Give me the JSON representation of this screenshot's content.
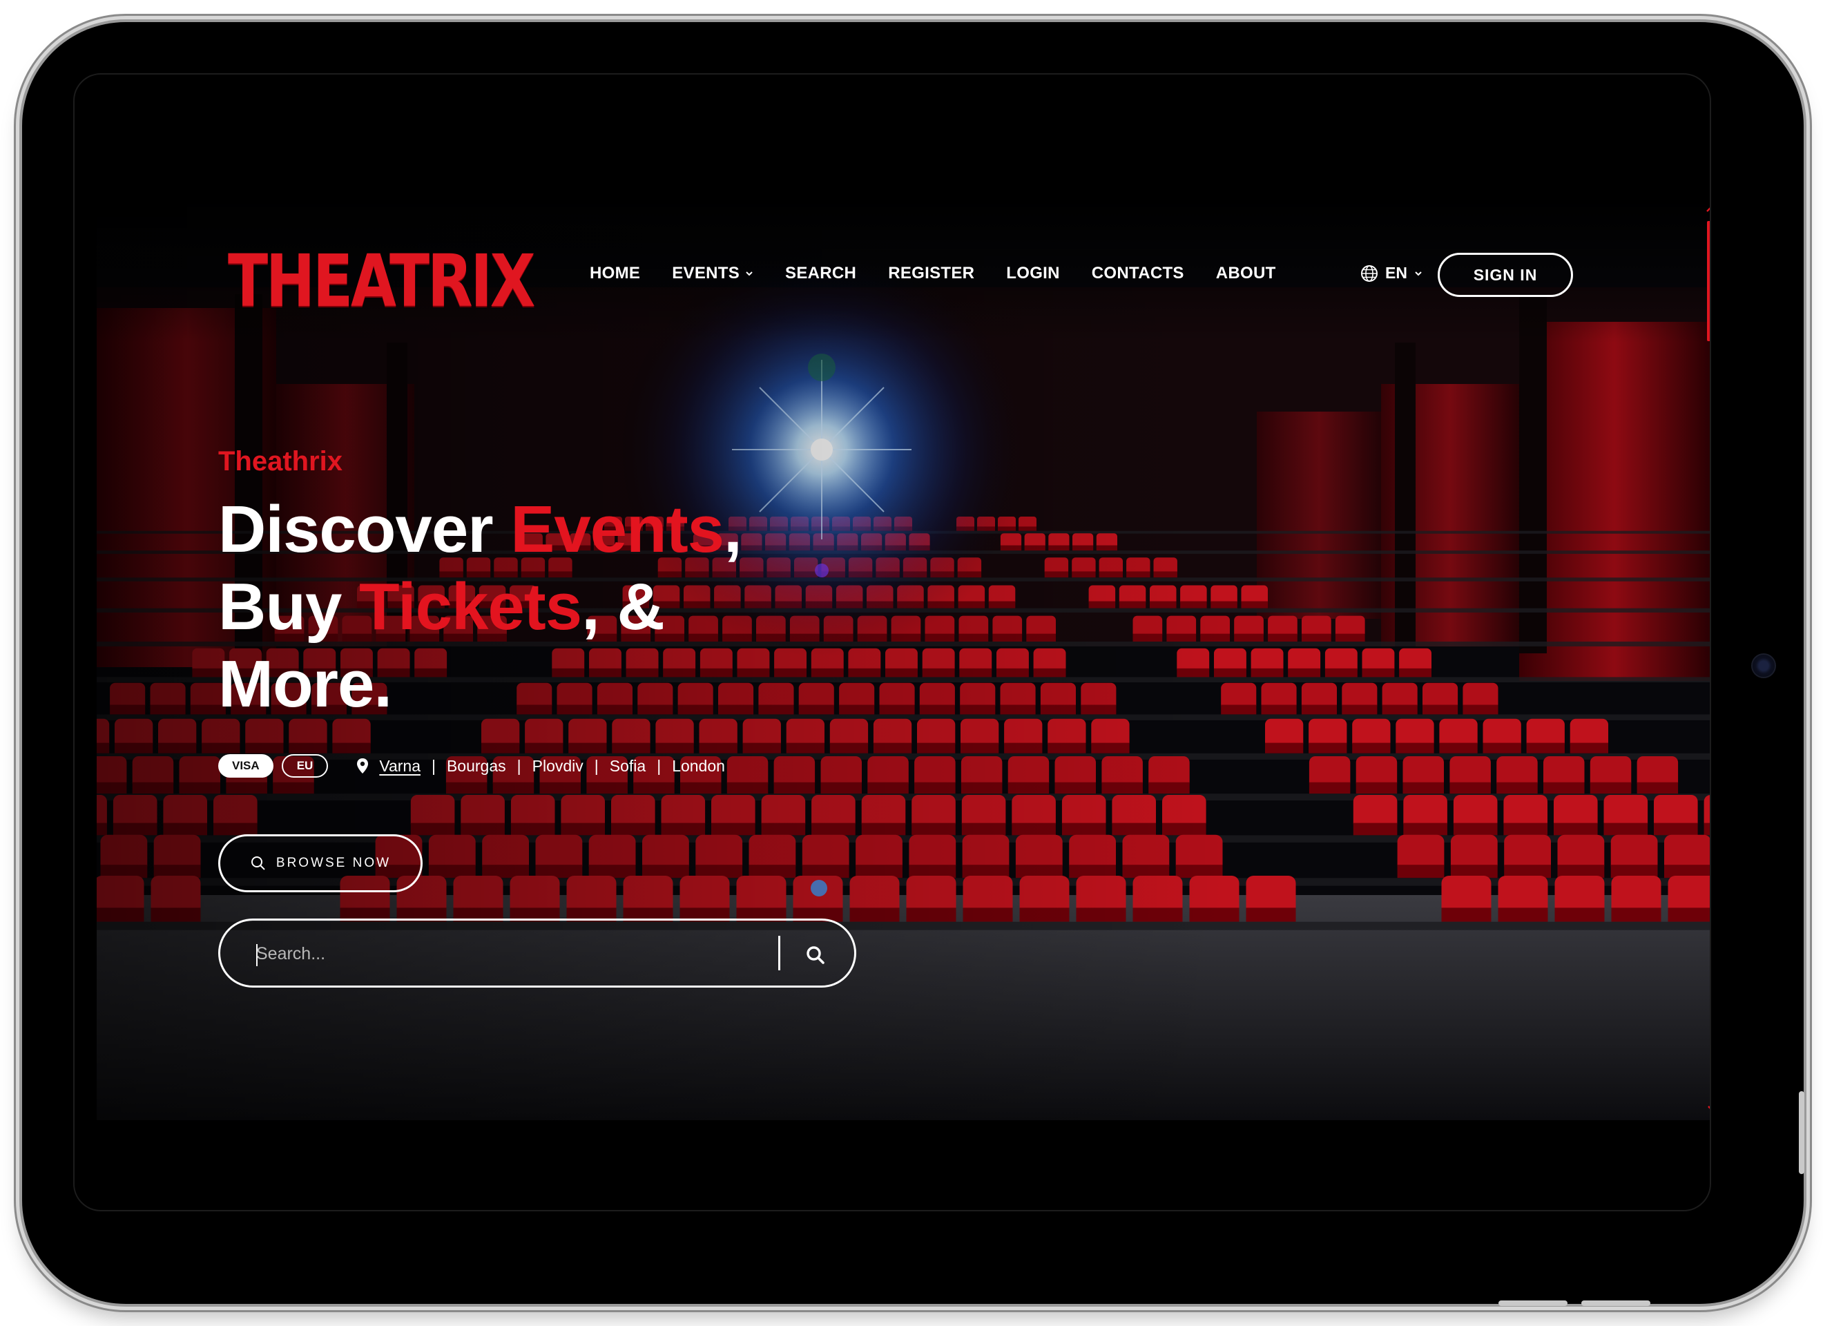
{
  "brand": {
    "logo_text": "THEATRIX",
    "accent_color": "#e01620"
  },
  "nav": {
    "items": [
      {
        "label": "HOME",
        "has_dropdown": false
      },
      {
        "label": "EVENTS",
        "has_dropdown": true
      },
      {
        "label": "SEARCH",
        "has_dropdown": false
      },
      {
        "label": "REGISTER",
        "has_dropdown": false
      },
      {
        "label": "LOGIN",
        "has_dropdown": false
      },
      {
        "label": "CONTACTS",
        "has_dropdown": false
      },
      {
        "label": "ABOUT",
        "has_dropdown": false
      }
    ],
    "language": "EN",
    "sign_in_label": "SIGN IN"
  },
  "hero": {
    "eyebrow": "Theathrix",
    "line1_white": "Discover ",
    "line1_red": "Events",
    "line1_end": ",",
    "line2_white": "Buy ",
    "line2_red": "Tickets",
    "line2_end": ", &",
    "line3": "More.",
    "badges": [
      "VISA",
      "EU"
    ],
    "cities": [
      "Varna",
      "Bourgas",
      "Plovdiv",
      "Sofia",
      "London"
    ],
    "browse_label": "BROWSE NOW",
    "search_placeholder": "Search..."
  },
  "icons": {
    "language": "globe-icon",
    "dropdown": "chevron-down-icon",
    "location": "map-pin-icon",
    "browse": "search-icon",
    "search_submit": "search-icon"
  },
  "scrollbar": {
    "position_fraction": 0.0
  }
}
